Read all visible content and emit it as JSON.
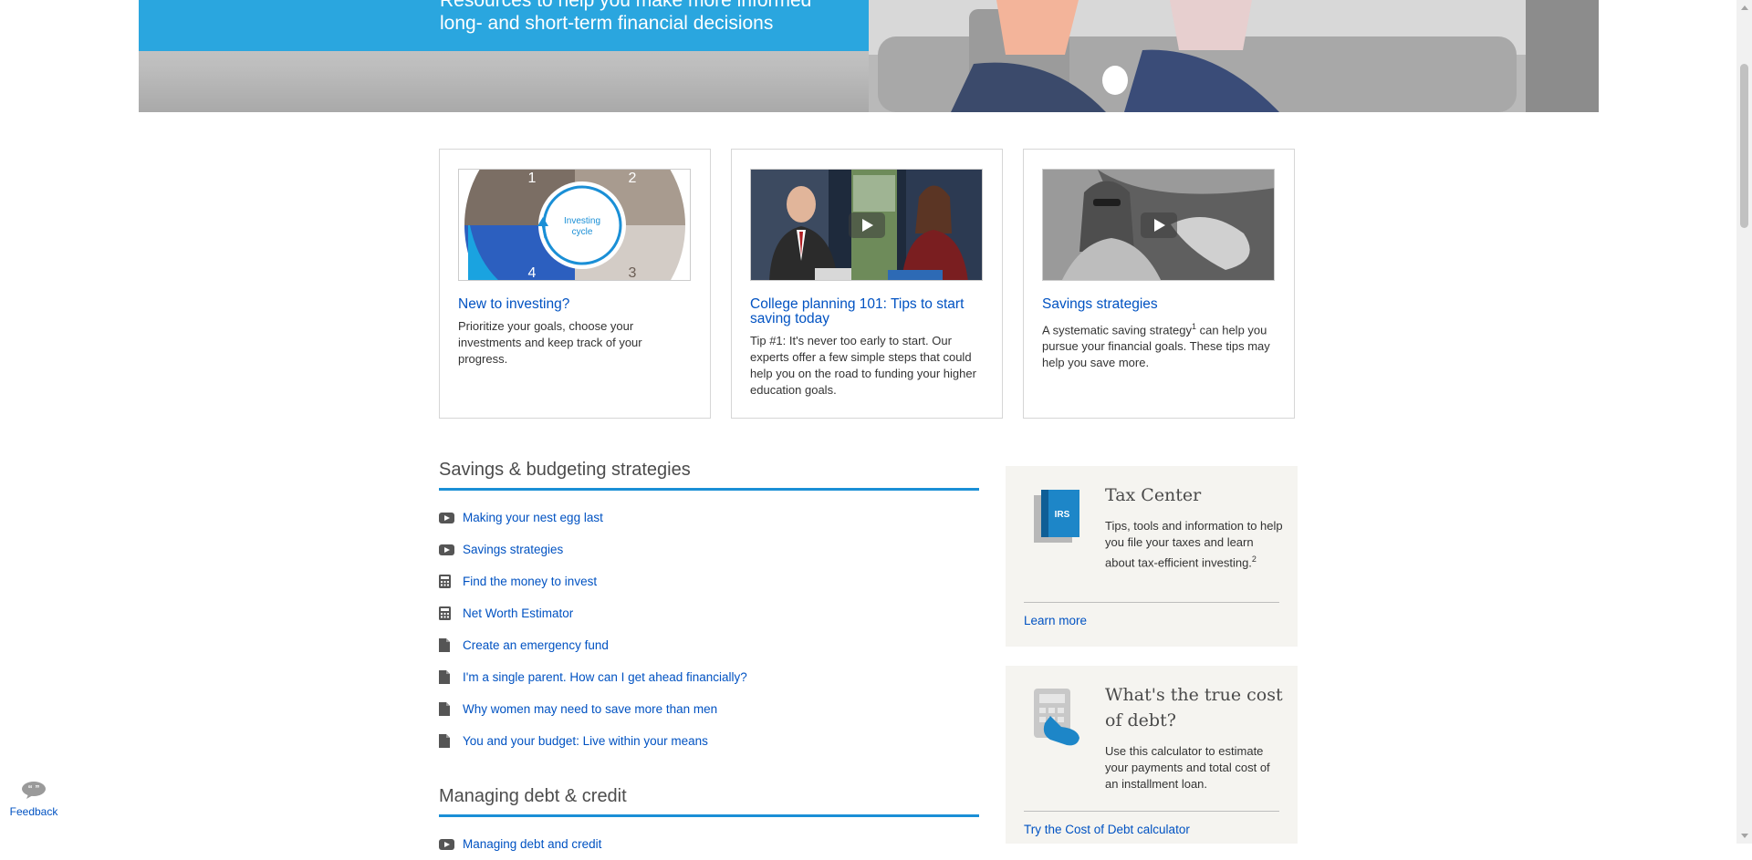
{
  "hero": {
    "line1": "Resources to help you make more informed",
    "line2": "long- and short-term financial decisions"
  },
  "cards": [
    {
      "title": "New to investing?",
      "desc": "Prioritize your goals, choose your investments and keep track of your progress.",
      "diagram": {
        "center_line1": "Investing",
        "center_line2": "cycle",
        "n1": "1",
        "n2": "2",
        "n3": "3",
        "n4": "4"
      }
    },
    {
      "title": "College planning 101: Tips to start saving today",
      "desc": "Tip #1: It's never too early to start. Our experts offer a few simple steps that could help you on the road to funding your higher education goals."
    },
    {
      "title": "Savings strategies",
      "desc_before": "A systematic saving strategy",
      "desc_sup": "1",
      "desc_after": " can help you pursue your financial goals. These tips may help you save more."
    }
  ],
  "savings_section": {
    "title": "Savings & budgeting strategies",
    "items": [
      {
        "label": "Making your nest egg last",
        "icon": "video-icon"
      },
      {
        "label": "Savings strategies",
        "icon": "video-icon"
      },
      {
        "label": "Find the money to invest",
        "icon": "calculator-icon"
      },
      {
        "label": "Net Worth Estimator",
        "icon": "calculator-icon"
      },
      {
        "label": "Create an emergency fund",
        "icon": "document-icon"
      },
      {
        "label": "I'm a single parent. How can I get ahead financially?",
        "icon": "document-icon"
      },
      {
        "label": "Why women may need to save more than men",
        "icon": "document-icon"
      },
      {
        "label": "You and your budget: Live within your means",
        "icon": "document-icon"
      }
    ]
  },
  "debt_section": {
    "title": "Managing debt & credit",
    "items": [
      {
        "label": "Managing debt and credit",
        "icon": "video-icon"
      }
    ]
  },
  "tax_panel": {
    "icon_text": "IRS",
    "title": "Tax Center",
    "desc": "Tips, tools and information to help you file your taxes and learn about tax-efficient investing.",
    "desc_sup": "2",
    "link": "Learn more"
  },
  "debt_panel": {
    "title": "What's the true cost of debt?",
    "desc": "Use this calculator to estimate your payments and total cost of an installment loan.",
    "link": "Try the Cost of Debt calculator"
  },
  "feedback": {
    "label": "Feedback"
  },
  "colors": {
    "link": "#0052c2",
    "accent": "#1a8fd6",
    "hero_blue": "#2aa6df",
    "panel_bg": "#f5f4f0"
  }
}
